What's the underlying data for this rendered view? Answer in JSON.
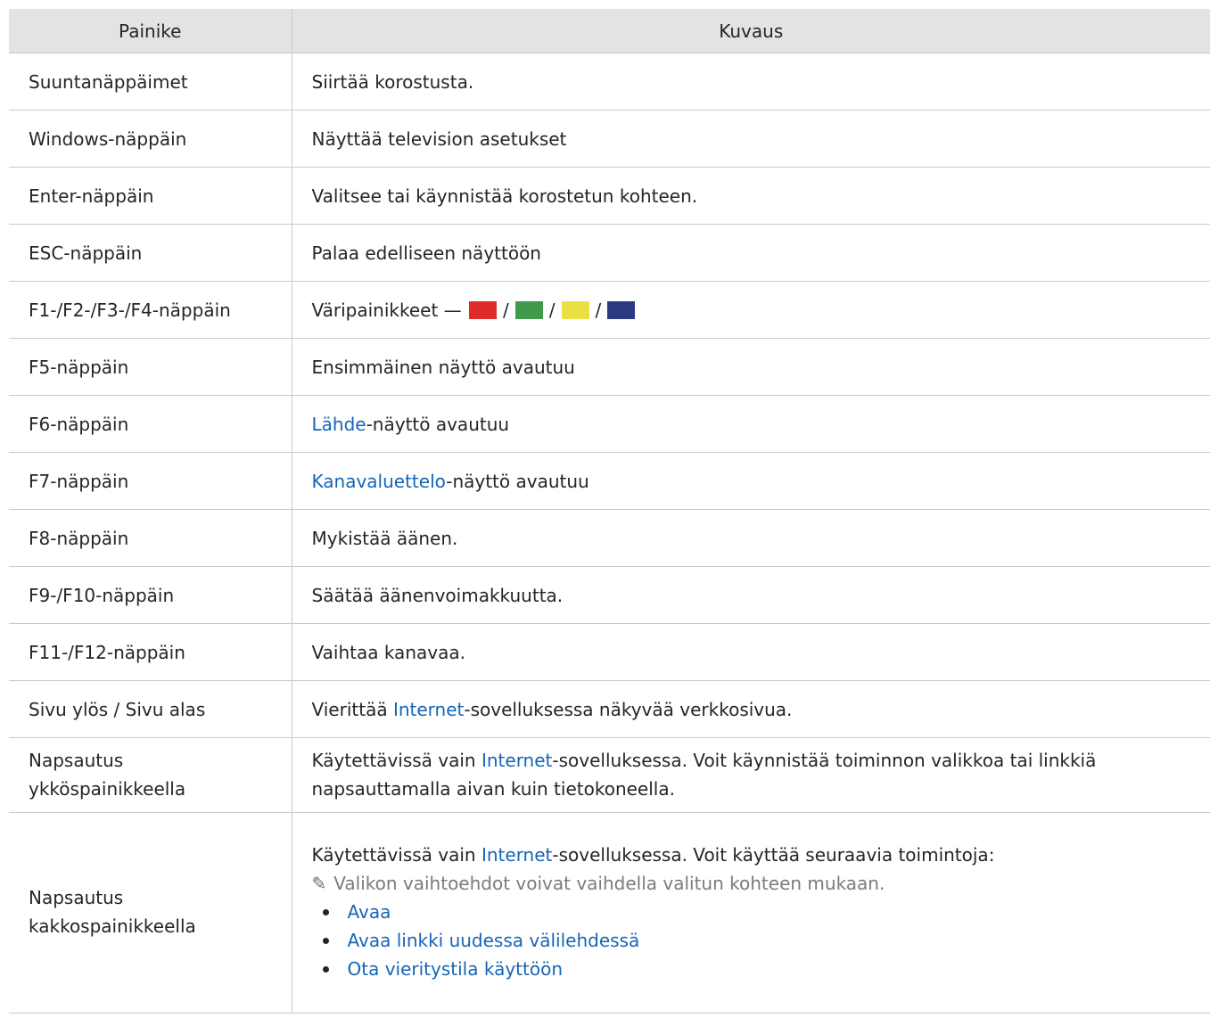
{
  "table": {
    "headers": [
      "Painike",
      "Kuvaus"
    ],
    "rows": [
      {
        "key": "Suuntanäppäimet",
        "desc": "Siirtää korostusta."
      },
      {
        "key": "Windows-näppäin",
        "desc": "Näyttää television asetukset"
      },
      {
        "key": "Enter-näppäin",
        "desc": "Valitsee tai käynnistää korostetun kohteen."
      },
      {
        "key": "ESC-näppäin",
        "desc": "Palaa edelliseen näyttöön"
      },
      {
        "key": "F1-/F2-/F3-/F4-näppäin",
        "desc_prefix": "Väripainikkeet —",
        "separator": "/"
      },
      {
        "key": "F5-näppäin",
        "desc": "Ensimmäinen näyttö avautuu"
      },
      {
        "key": "F6-näppäin",
        "link": "Lähde",
        "desc_suffix": "-näyttö avautuu"
      },
      {
        "key": "F7-näppäin",
        "link": "Kanavaluettelo",
        "desc_suffix": "-näyttö avautuu"
      },
      {
        "key": "F8-näppäin",
        "desc": "Mykistää äänen."
      },
      {
        "key": "F9-/F10-näppäin",
        "desc": "Säätää äänenvoimakkuutta."
      },
      {
        "key": "F11-/F12-näppäin",
        "desc": "Vaihtaa kanavaa."
      },
      {
        "key": "Sivu ylös / Sivu alas",
        "desc_prefix": "Vierittää ",
        "link": "Internet",
        "desc_suffix": "-sovelluksessa näkyvää verkkosivua."
      },
      {
        "key_line1": "Napsautus",
        "key_line2": "ykköspainikkeella",
        "desc_prefix": "Käytettävissä vain ",
        "link": "Internet",
        "desc_suffix_line1": "-sovelluksessa. Voit käynnistää toiminnon valikkoa tai linkkiä",
        "desc_line2": "napsauttamalla aivan kuin tietokoneella."
      },
      {
        "key_line1": "Napsautus",
        "key_line2": "kakkospainikkeella",
        "desc_prefix": "Käytettävissä vain ",
        "link": "Internet",
        "desc_suffix": "-sovelluksessa. Voit käyttää seuraavia toimintoja:",
        "note": "Valikon vaihtoehdot voivat vaihdella valitun kohteen mukaan.",
        "bullets": [
          "Avaa",
          "Avaa linkki uudessa välilehdessä",
          "Ota vieritystila käyttöön"
        ]
      }
    ]
  },
  "colors": {
    "red": "#e02b2b",
    "green": "#3f9a4c",
    "yellow": "#ecdf45",
    "blue": "#2c3a82",
    "link": "#1565b8",
    "header_bg": "#e3e3e3"
  },
  "icons": {
    "note": "pencil-icon"
  }
}
